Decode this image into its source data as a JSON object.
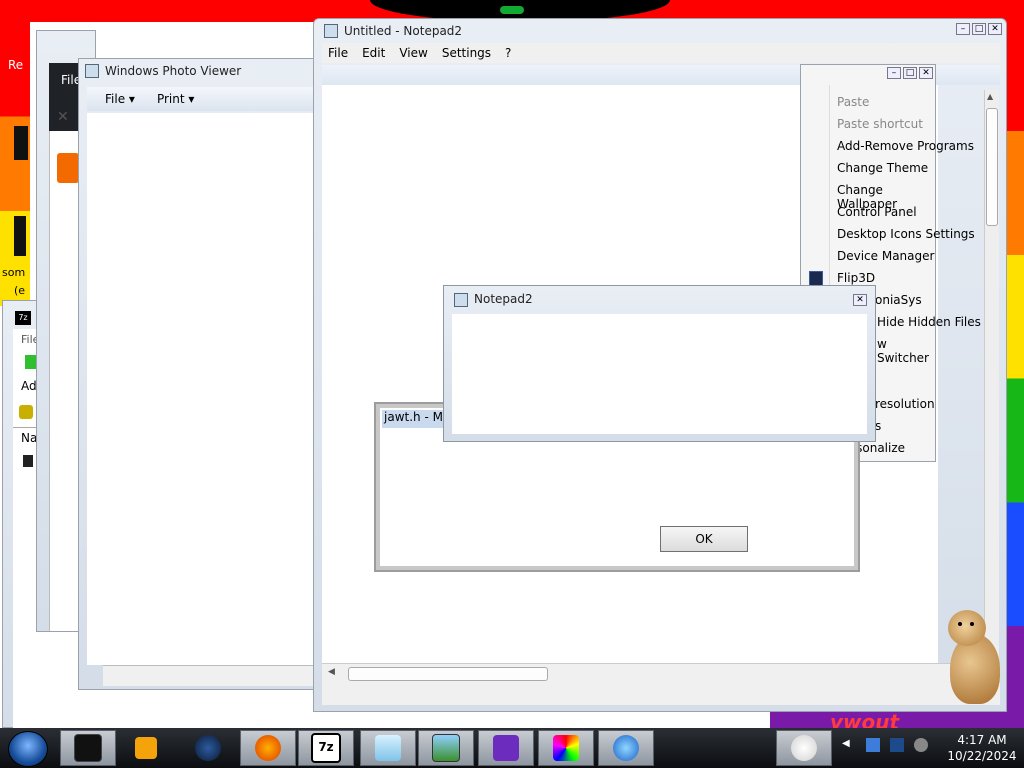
{
  "photo_viewer": {
    "title": "Windows Photo Viewer",
    "menu": [
      "File",
      "Print"
    ]
  },
  "notepad2_main": {
    "title": "Untitled - Notepad2",
    "menu": [
      "File",
      "Edit",
      "View",
      "Settings",
      "?"
    ]
  },
  "context_menu": {
    "items": [
      "Paste",
      "Paste shortcut",
      "Add-Remove Programs",
      "Change Theme",
      "Change Wallpaper",
      "Control Panel",
      "Desktop Icons Settings",
      "Device Manager",
      "Flip3D",
      "oniaSys",
      "Hide Hidden Files",
      "w Switcher",
      "resolution",
      "s",
      "Personalize"
    ]
  },
  "dialog": {
    "title": "Notepad2"
  },
  "back_dialog": {
    "title_fragment": "jawt.h - Mi",
    "ok_label": "OK"
  },
  "left_window": {
    "title_fragment": "File",
    "close_glyph": "✕"
  },
  "sevenzip": {
    "menu_fragment": "File",
    "add_fragment": "Ad",
    "col_fragment": "Na"
  },
  "desktop": {
    "left_texts": [
      "Re",
      "som",
      "(e"
    ],
    "watermark": "vwout"
  },
  "taskbar": {
    "time": "4:17 AM",
    "date": "10/22/2024",
    "colors": {
      "accent": "#1a4dff"
    }
  }
}
